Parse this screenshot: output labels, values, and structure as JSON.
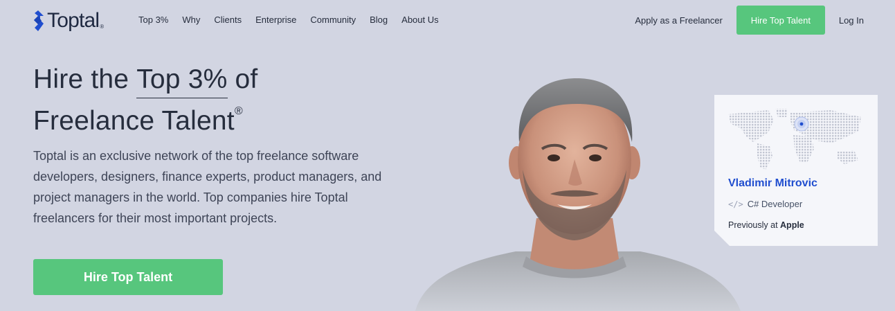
{
  "nav": {
    "logo_text": "Toptal",
    "logo_reg": "®",
    "links": [
      "Top 3%",
      "Why",
      "Clients",
      "Enterprise",
      "Community",
      "Blog",
      "About Us"
    ],
    "apply": "Apply as a Freelancer",
    "hire_button": "Hire Top Talent",
    "login": "Log In"
  },
  "hero": {
    "title_pre": "Hire the ",
    "title_highlight": "Top 3%",
    "title_post": " of",
    "title_line2": "Freelance Talent",
    "title_reg": "®",
    "description": "Toptal is an exclusive network of the top freelance software developers, designers, finance experts, product managers, and project managers in the world. Top companies hire Toptal freelancers for their most important projects.",
    "cta": "Hire Top Talent"
  },
  "card": {
    "name": "Vladimir Mitrovic",
    "role_icon": "code-icon",
    "role": "C# Developer",
    "previously_label": "Previously at ",
    "company": "Apple"
  },
  "colors": {
    "background": "#d2d5e2",
    "accent_green": "#57c67d",
    "brand_blue": "#204ecf",
    "text_dark": "#262d3d"
  }
}
